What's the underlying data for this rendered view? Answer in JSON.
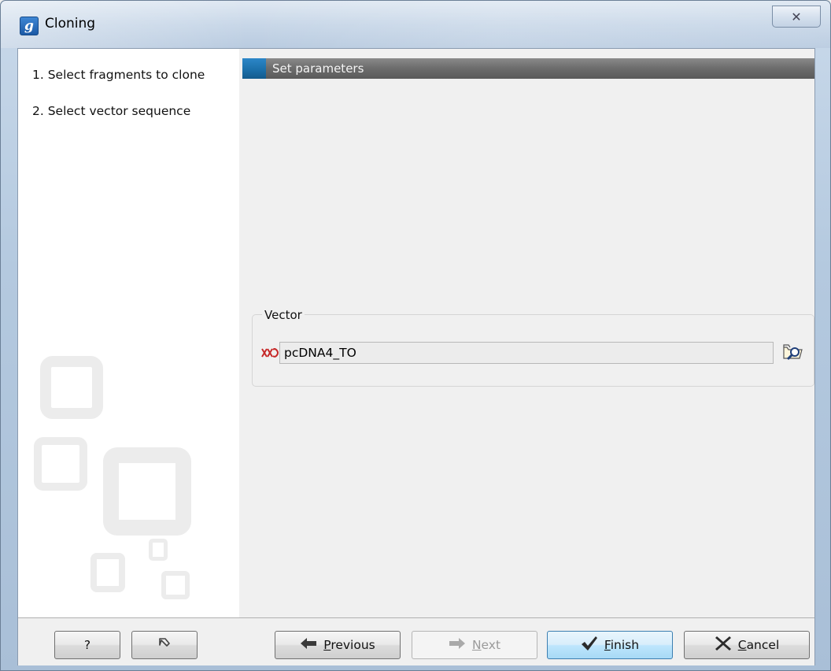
{
  "window": {
    "title": "Cloning",
    "app_icon_letter": "g",
    "close_glyph": "✕"
  },
  "steps": [
    {
      "label": "1.  Select fragments to clone"
    },
    {
      "label": "2.  Select vector sequence"
    }
  ],
  "section": {
    "title": "Set parameters"
  },
  "vector": {
    "legend": "Vector",
    "value": "pcDNA4_TO",
    "sequence_icon": "sequence-icon",
    "browse_icon": "folder-search-icon"
  },
  "buttons": {
    "help": "?",
    "reset_icon": "reset-icon",
    "previous": {
      "mnemonic": "P",
      "rest": "revious",
      "icon": "arrow-left-icon"
    },
    "next": {
      "mnemonic": "N",
      "rest": "ext",
      "icon": "arrow-right-icon",
      "enabled": false
    },
    "finish": {
      "mnemonic": "F",
      "rest": "inish",
      "icon": "checkmark-icon"
    },
    "cancel": {
      "mnemonic": "C",
      "rest": "ancel",
      "icon": "x-icon"
    }
  }
}
